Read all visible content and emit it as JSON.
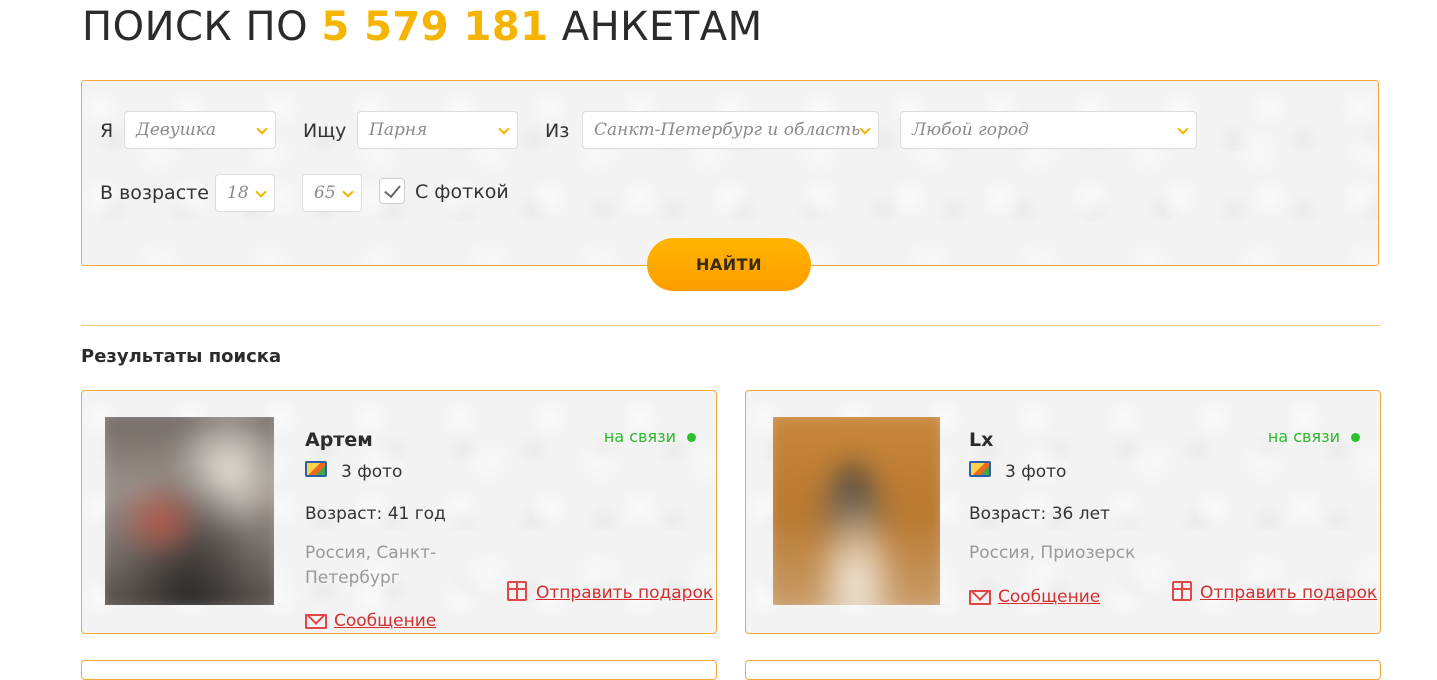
{
  "header": {
    "title_prefix": "ПОИСК ПО",
    "title_count": "5 579 181",
    "title_suffix": "АНКЕТАМ"
  },
  "search": {
    "i_label": "Я",
    "i_value": "Девушка",
    "seek_label": "Ищу",
    "seek_value": "Парня",
    "from_label": "Из",
    "region_value": "Санкт-Петербург и область",
    "city_value": "Любой город",
    "age_label": "В возрасте",
    "age_from": "18",
    "age_to": "65",
    "photo_label": "С фоткой",
    "photo_checked": true,
    "find_button": "НАЙТИ"
  },
  "results": {
    "title": "Результаты поиска",
    "cards": [
      {
        "name": "Артем",
        "photos": "3 фото",
        "age": "Возраст: 41 год",
        "location": "Россия, Санкт-Петербург",
        "status": "на связи",
        "status_color": "#2eb82e",
        "gift_label": "Отправить подарок",
        "message_label": "Сообщение"
      },
      {
        "name": "Lx",
        "photos": "3 фото",
        "age": "Возраст: 36 лет",
        "location": "Россия, Приозерск",
        "status": "на связи",
        "status_color": "#2eb82e",
        "gift_label": "Отправить подарок",
        "message_label": "Сообщение"
      }
    ]
  },
  "colors": {
    "accent": "#f5b400",
    "border": "#f0a83a",
    "link": "#d32f2f",
    "online": "#2eb82e"
  }
}
